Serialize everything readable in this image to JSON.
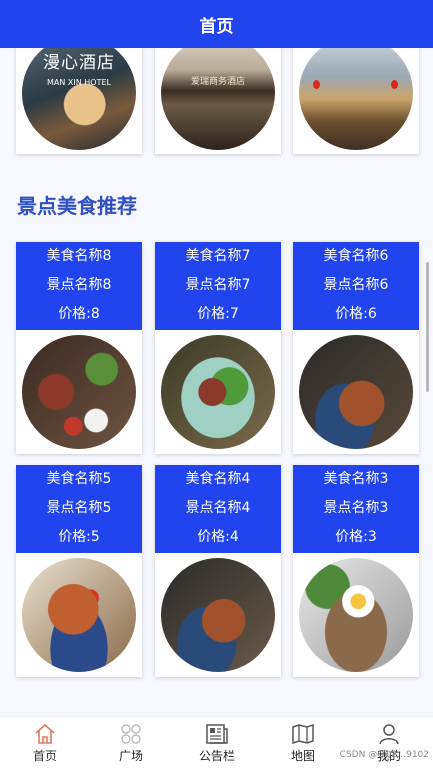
{
  "header": {
    "title": "首页"
  },
  "hotels": [
    {
      "sign": "漫心酒店",
      "sign_small": "MAN XIN HOTEL"
    },
    {
      "sign": "爱瑞商务酒店"
    },
    {
      "sign": ""
    }
  ],
  "section": {
    "title": "景点美食推荐"
  },
  "foods": [
    {
      "food": "美食名称8",
      "spot": "景点名称8",
      "price": "价格:8"
    },
    {
      "food": "美食名称7",
      "spot": "景点名称7",
      "price": "价格:7"
    },
    {
      "food": "美食名称6",
      "spot": "景点名称6",
      "price": "价格:6"
    },
    {
      "food": "美食名称5",
      "spot": "景点名称5",
      "price": "价格:5"
    },
    {
      "food": "美食名称4",
      "spot": "景点名称4",
      "price": "价格:4"
    },
    {
      "food": "美食名称3",
      "spot": "景点名称3",
      "price": "价格:3"
    }
  ],
  "tabbar": {
    "items": [
      {
        "label": "首页",
        "icon": "home-icon"
      },
      {
        "label": "广场",
        "icon": "grid-icon"
      },
      {
        "label": "公告栏",
        "icon": "news-icon"
      },
      {
        "label": "地图",
        "icon": "map-icon"
      },
      {
        "label": "我的",
        "icon": "user-icon"
      }
    ]
  },
  "watermark": "CSDN @QQ2…9102",
  "colors": {
    "brand": "#2244ee",
    "section_title": "#2f4fc4",
    "active_tab": "#e07a5f"
  }
}
